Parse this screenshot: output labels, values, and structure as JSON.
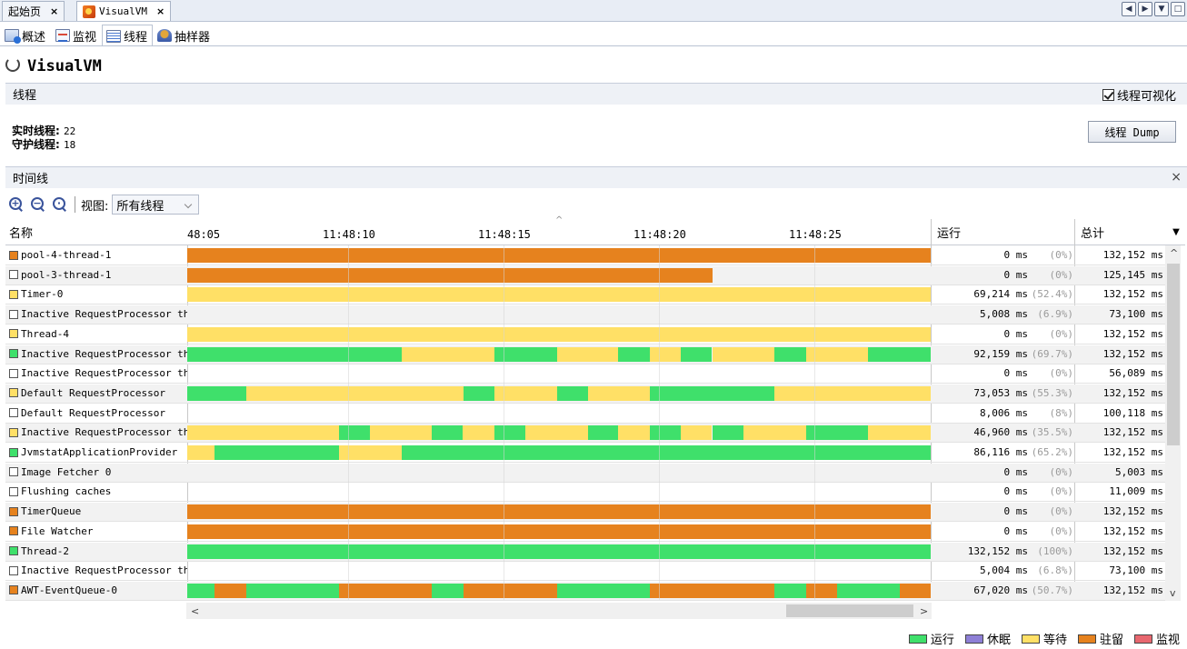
{
  "doc_tabs": {
    "start": "起始页",
    "visualvm": "VisualVM",
    "close_glyph": "×"
  },
  "sub_tabs": [
    "概述",
    "监视",
    "线程",
    "抽样器"
  ],
  "app_title": "VisualVM",
  "threads_section": {
    "title": "线程",
    "visualize_label": "线程可视化",
    "live_label": "实时线程",
    "live_value": "22",
    "daemon_label": "守护线程",
    "daemon_value": "18",
    "dump_button": "线程 Dump"
  },
  "timeline_section": {
    "title": "时间线",
    "view_label": "视图:",
    "view_selected": "所有线程"
  },
  "columns": {
    "name": "名称",
    "running": "运行",
    "total": "总计"
  },
  "ticks": [
    "48:05",
    "11:48:10",
    "11:48:15",
    "11:48:20",
    "11:48:25"
  ],
  "colors": {
    "running": "#3fe06b",
    "sleeping": "#8e7fd6",
    "wait": "#ffe066",
    "park": "#e6821e",
    "monitor": "#e8676f"
  },
  "legend": [
    {
      "key": "running",
      "label": "运行"
    },
    {
      "key": "sleeping",
      "label": "休眠"
    },
    {
      "key": "wait",
      "label": "等待"
    },
    {
      "key": "park",
      "label": "驻留"
    },
    {
      "key": "monitor",
      "label": "监视"
    }
  ],
  "threads": [
    {
      "name": "pool-4-thread-1",
      "state": "park",
      "running": "0 ms",
      "pct": "(0%)",
      "total": "132,152 ms",
      "segments": [
        [
          "park",
          0,
          1
        ]
      ]
    },
    {
      "name": "pool-3-thread-1",
      "state": "none",
      "running": "0 ms",
      "pct": "(0%)",
      "total": "125,145 ms",
      "segments": [
        [
          "park",
          0,
          0.707
        ]
      ]
    },
    {
      "name": "Timer-0",
      "state": "wait",
      "running": "69,214 ms",
      "pct": "(52.4%)",
      "total": "132,152 ms",
      "segments": [
        [
          "wait",
          0,
          1
        ]
      ]
    },
    {
      "name": "Inactive RequestProcessor thread [Was:Explorer Builder Processor/org.netbeans.modules.profiler.v2.ProfilerWindow$1]",
      "state": "none",
      "running": "5,008 ms",
      "pct": "(6.9%)",
      "total": "73,100 ms",
      "segments": []
    },
    {
      "name": "Thread-4",
      "state": "wait",
      "running": "0 ms",
      "pct": "(0%)",
      "total": "132,152 ms",
      "segments": [
        [
          "wait",
          0,
          1
        ]
      ]
    },
    {
      "name": "Inactive RequestProcessor thread [Was:Default RequestProcessor/null]",
      "state": "running",
      "running": "92,159 ms",
      "pct": "(69.7%)",
      "total": "132,152 ms",
      "segments": [
        [
          "running",
          0,
          0.288
        ],
        [
          "wait",
          0.288,
          0.413
        ],
        [
          "running",
          0.413,
          0.497
        ],
        [
          "wait",
          0.497,
          0.58
        ],
        [
          "running",
          0.58,
          0.622
        ],
        [
          "wait",
          0.622,
          0.664
        ],
        [
          "running",
          0.664,
          0.706
        ],
        [
          "wait",
          0.706,
          0.79
        ],
        [
          "running",
          0.79,
          0.832
        ],
        [
          "wait",
          0.832,
          0.916
        ],
        [
          "running",
          0.916,
          1
        ]
      ]
    },
    {
      "name": "Inactive RequestProcessor thread [Was:Default RequestProcessor/null]",
      "state": "none",
      "running": "0 ms",
      "pct": "(0%)",
      "total": "56,089 ms",
      "segments": []
    },
    {
      "name": "Default RequestProcessor",
      "state": "wait",
      "running": "73,053 ms",
      "pct": "(55.3%)",
      "total": "132,152 ms",
      "segments": [
        [
          "running",
          0,
          0.079
        ],
        [
          "wait",
          0.079,
          0.372
        ],
        [
          "running",
          0.372,
          0.413
        ],
        [
          "wait",
          0.413,
          0.497
        ],
        [
          "running",
          0.497,
          0.539
        ],
        [
          "wait",
          0.539,
          0.622
        ],
        [
          "running",
          0.622,
          0.79
        ],
        [
          "wait",
          0.79,
          1
        ]
      ]
    },
    {
      "name": "Default RequestProcessor",
      "state": "none",
      "running": "8,006 ms",
      "pct": "(8%)",
      "total": "100,118 ms",
      "segments": []
    },
    {
      "name": "Inactive RequestProcessor thread [Was:Default RequestProcessor/null]",
      "state": "wait",
      "running": "46,960 ms",
      "pct": "(35.5%)",
      "total": "132,152 ms",
      "segments": [
        [
          "wait",
          0,
          0.204
        ],
        [
          "running",
          0.204,
          0.246
        ],
        [
          "wait",
          0.246,
          0.329
        ],
        [
          "running",
          0.329,
          0.371
        ],
        [
          "wait",
          0.371,
          0.413
        ],
        [
          "running",
          0.413,
          0.455
        ],
        [
          "wait",
          0.455,
          0.539
        ],
        [
          "running",
          0.539,
          0.58
        ],
        [
          "wait",
          0.58,
          0.622
        ],
        [
          "running",
          0.622,
          0.664
        ],
        [
          "wait",
          0.664,
          0.706
        ],
        [
          "running",
          0.706,
          0.748
        ],
        [
          "wait",
          0.748,
          0.832
        ],
        [
          "running",
          0.832,
          0.916
        ],
        [
          "wait",
          0.916,
          1
        ]
      ]
    },
    {
      "name": "JvmstatApplicationProvider",
      "state": "running",
      "running": "86,116 ms",
      "pct": "(65.2%)",
      "total": "132,152 ms",
      "segments": [
        [
          "wait",
          0,
          0.037
        ],
        [
          "running",
          0.037,
          0.204
        ],
        [
          "wait",
          0.204,
          0.288
        ],
        [
          "running",
          0.288,
          1
        ]
      ]
    },
    {
      "name": "Image Fetcher 0",
      "state": "none",
      "running": "0 ms",
      "pct": "(0%)",
      "total": "5,003 ms",
      "segments": []
    },
    {
      "name": "Flushing caches",
      "state": "none",
      "running": "0 ms",
      "pct": "(0%)",
      "total": "11,009 ms",
      "segments": []
    },
    {
      "name": "TimerQueue",
      "state": "park",
      "running": "0 ms",
      "pct": "(0%)",
      "total": "132,152 ms",
      "segments": [
        [
          "park",
          0,
          1
        ]
      ]
    },
    {
      "name": "File Watcher",
      "state": "park",
      "running": "0 ms",
      "pct": "(0%)",
      "total": "132,152 ms",
      "segments": [
        [
          "park",
          0,
          1
        ]
      ]
    },
    {
      "name": "Thread-2",
      "state": "running",
      "running": "132,152 ms",
      "pct": "(100%)",
      "total": "132,152 ms",
      "segments": [
        [
          "running",
          0,
          1
        ]
      ]
    },
    {
      "name": "Inactive RequestProcessor thread [Was:Explorer Builder Processor/org.netbeans.modules.profiler.v2.ProfilerWindow$1]",
      "state": "none",
      "running": "5,004 ms",
      "pct": "(6.8%)",
      "total": "73,100 ms",
      "segments": []
    },
    {
      "name": "AWT-EventQueue-0",
      "state": "park",
      "running": "67,020 ms",
      "pct": "(50.7%)",
      "total": "132,152 ms",
      "segments": [
        [
          "running",
          0,
          0.037
        ],
        [
          "park",
          0.037,
          0.079
        ],
        [
          "running",
          0.079,
          0.204
        ],
        [
          "park",
          0.204,
          0.329
        ],
        [
          "running",
          0.329,
          0.372
        ],
        [
          "park",
          0.372,
          0.497
        ],
        [
          "running",
          0.497,
          0.622
        ],
        [
          "park",
          0.622,
          0.79
        ],
        [
          "running",
          0.79,
          0.832
        ],
        [
          "park",
          0.832,
          0.874
        ],
        [
          "running",
          0.874,
          0.958
        ],
        [
          "park",
          0.958,
          1
        ]
      ]
    }
  ]
}
